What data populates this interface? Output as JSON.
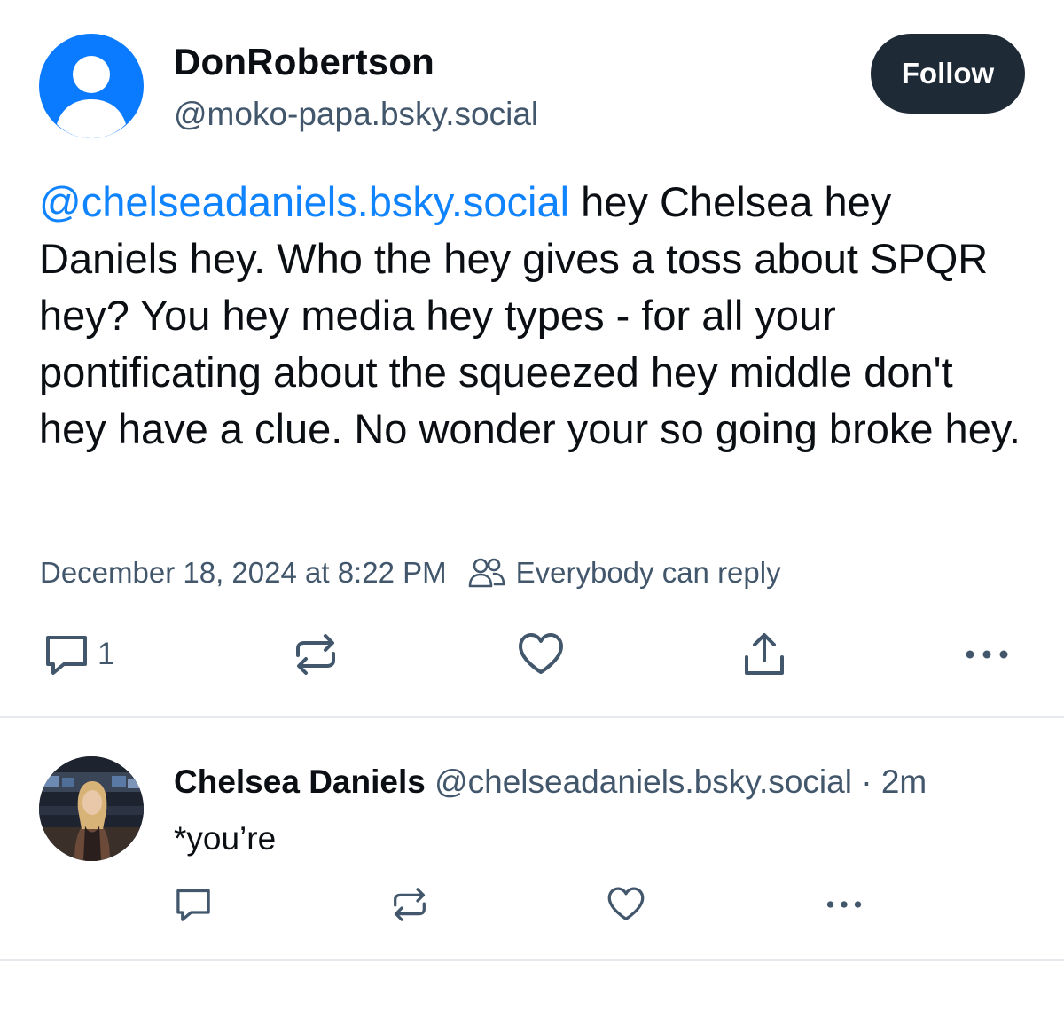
{
  "post": {
    "author_name": "DonRobertson",
    "author_handle": "@moko-papa.bsky.social",
    "follow_label": "Follow",
    "mention": "@chelseadaniels.bsky.social",
    "text": " hey Chelsea hey Daniels hey. Who the hey gives a toss about SPQR hey? You hey media hey types - for all your pontificating about the squeezed hey middle don't hey have a clue. No wonder your so going broke hey.",
    "timestamp": "December 18, 2024 at 8:22 PM",
    "reply_setting": "Everybody can reply",
    "reply_count": "1",
    "icons": [
      "reply-icon",
      "repost-icon",
      "like-icon",
      "share-icon",
      "more-icon",
      "people-icon"
    ]
  },
  "reply": {
    "author_name": "Chelsea Daniels",
    "author_handle": "@chelseadaniels.bsky.social",
    "separator": "·",
    "time": "2m",
    "text": "*you’re"
  },
  "colors": {
    "accent_link": "#1083fe",
    "avatar_blue": "#0a7aff",
    "follow_bg": "#1f2a37",
    "muted_text": "#42576c",
    "icon_color": "#42576c"
  }
}
